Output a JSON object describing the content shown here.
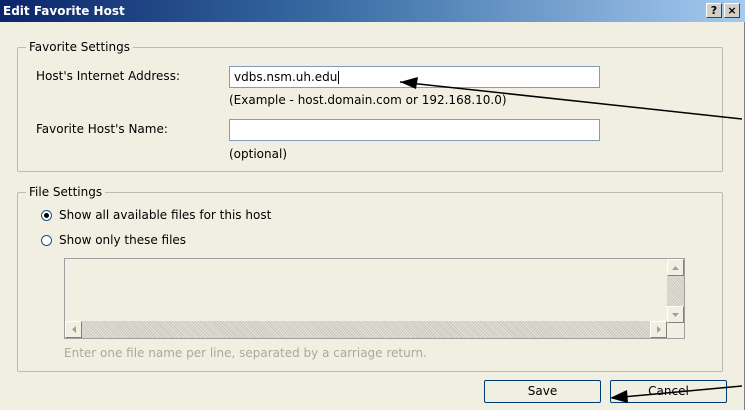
{
  "window": {
    "title": "Edit Favorite Host",
    "help_label": "?",
    "close_label": "×"
  },
  "favorite_settings": {
    "group_title": "Favorite Settings",
    "address_label": "Host's Internet Address:",
    "address_value": "vdbs.nsm.uh.edu",
    "address_example": "(Example - host.domain.com or 192.168.10.0)",
    "name_label": "Favorite Host's Name:",
    "name_value": "",
    "name_hint": "(optional)"
  },
  "file_settings": {
    "group_title": "File Settings",
    "option_all": "Show all available files for this host",
    "option_only": "Show only these files",
    "selected": "all",
    "files_hint": "Enter one file name per line, separated by a carriage return."
  },
  "buttons": {
    "save": "Save",
    "cancel": "Cancel"
  },
  "colors": {
    "title_bar": "#0a246a",
    "dialog_bg": "#f1efe2",
    "disabled_text": "#aca899",
    "annotation_arrow": "#000000"
  }
}
